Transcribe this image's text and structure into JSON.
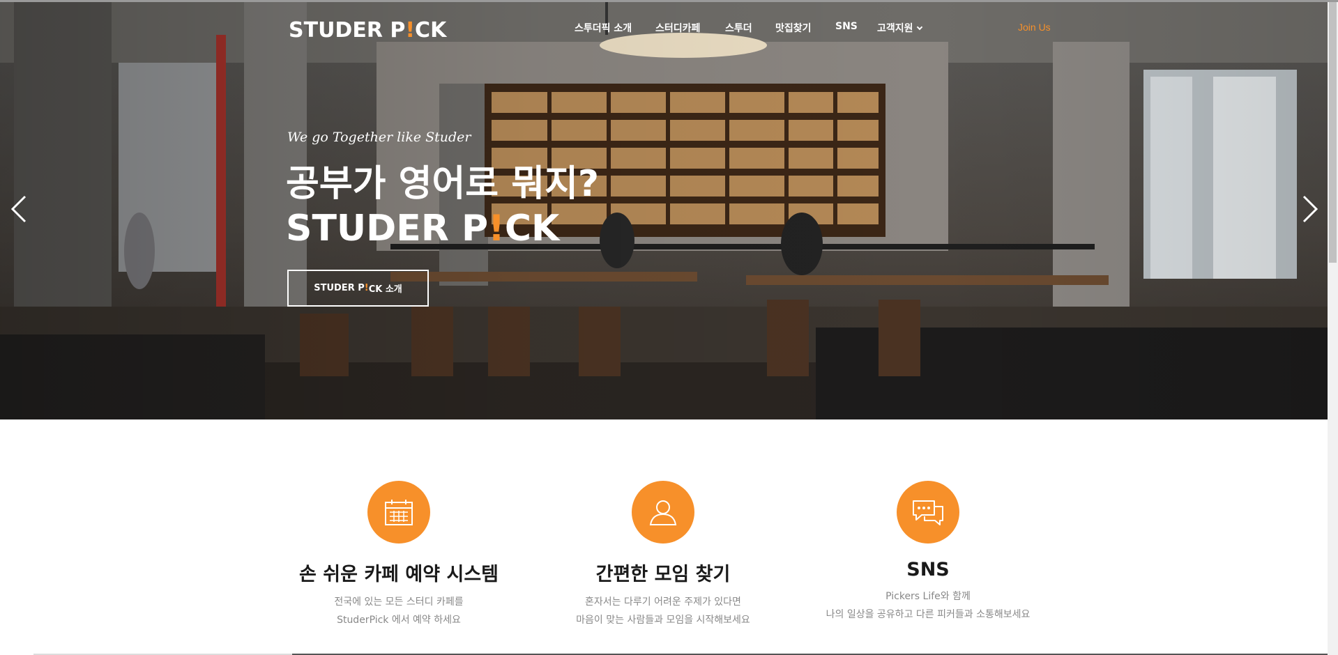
{
  "brand": {
    "logo_pre": "STUDER P",
    "logo_bang": "!",
    "logo_post": "CK",
    "accent": "#f7902a"
  },
  "nav": {
    "items": [
      "스투더픽 소개",
      "스터디카페",
      "스투더",
      "맛집찾기",
      "SNS",
      "고객지원"
    ],
    "join": "Join Us"
  },
  "hero": {
    "subtitle": "We go Together like Studer",
    "title_line1": "공부가 영어로 뭐지?",
    "title_line2_pre": "STUDER P",
    "title_line2_bang": "!",
    "title_line2_post": "CK",
    "button_pre": "STUDER P",
    "button_bang": "!",
    "button_post": "CK 소개"
  },
  "features": [
    {
      "icon": "calendar-icon",
      "title": "손 쉬운 카페 예약 시스템",
      "desc1": "전국에 있는 모든 스터디 카페를",
      "desc2": "StuderPick 에서 예약 하세요"
    },
    {
      "icon": "user-icon",
      "title": "간편한 모임 찾기",
      "desc1": "혼자서는 다루기 어려운 주제가 있다면",
      "desc2": "마음이 맞는 사람들과 모임을 시작해보세요"
    },
    {
      "icon": "chat-icon",
      "title": "SNS",
      "desc1": "Pickers Life와 함께",
      "desc2": "나의 일상을 공유하고 다른 피커들과 소통해보세요"
    }
  ]
}
